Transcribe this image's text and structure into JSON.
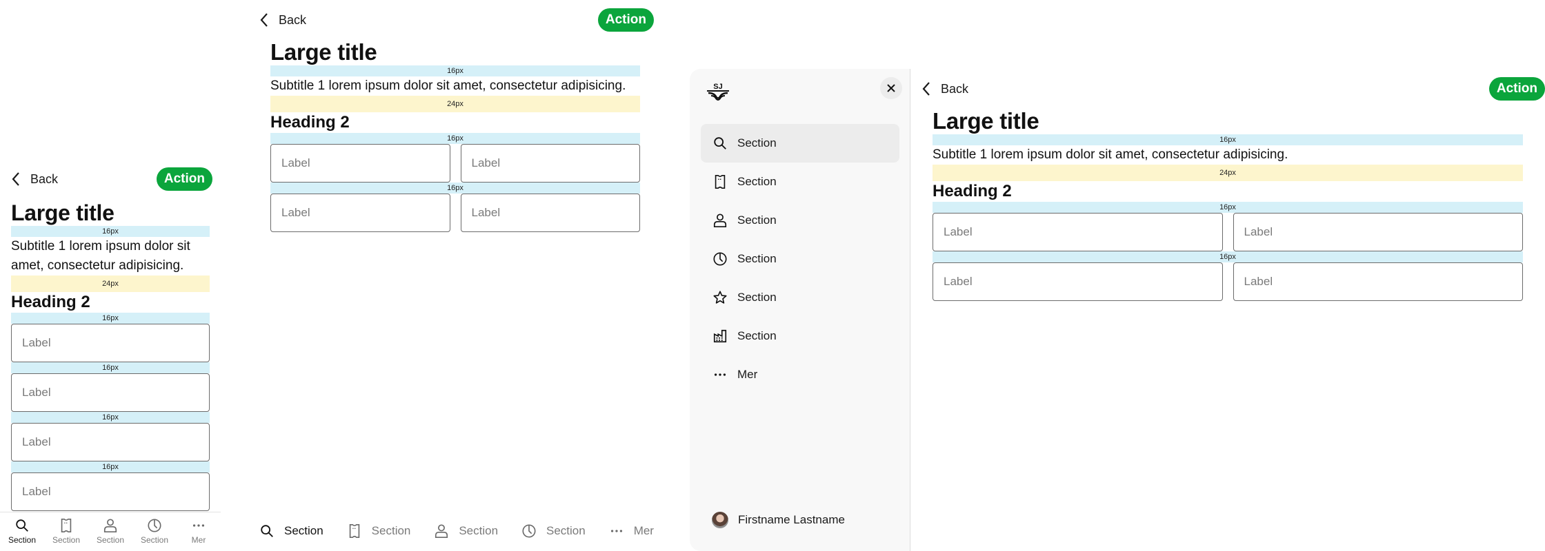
{
  "colors": {
    "action_green": "#0ba53c",
    "spacer_16": "#d5f0f8",
    "spacer_24": "#fdf5cd",
    "sidebar_bg": "#f8f8f8",
    "active_item_bg": "#ececec"
  },
  "topbar": {
    "back_label": "Back",
    "back_icon": "chevron-left-icon",
    "action_label": "Action"
  },
  "content": {
    "large_title": "Large title",
    "subtitle": "Subtitle 1 lorem ipsum dolor sit amet, consectetur adipisicing.",
    "heading2": "Heading 2",
    "spacer_16_label": "16px",
    "spacer_24_label": "24px",
    "field_label": "Label"
  },
  "mobile": {
    "fields": [
      "Label",
      "Label",
      "Label",
      "Label"
    ],
    "nav": [
      {
        "label": "Section",
        "icon": "search-icon",
        "active": true
      },
      {
        "label": "Section",
        "icon": "ticket-icon",
        "active": false
      },
      {
        "label": "Section",
        "icon": "person-icon",
        "active": false
      },
      {
        "label": "Section",
        "icon": "clock-icon",
        "active": false
      },
      {
        "label": "Mer",
        "icon": "more-icon",
        "active": false
      }
    ]
  },
  "tablet": {
    "fields": [
      "Label",
      "Label",
      "Label",
      "Label"
    ],
    "nav": [
      {
        "label": "Section",
        "icon": "search-icon",
        "active": true
      },
      {
        "label": "Section",
        "icon": "ticket-icon",
        "active": false
      },
      {
        "label": "Section",
        "icon": "person-icon",
        "active": false
      },
      {
        "label": "Section",
        "icon": "clock-icon",
        "active": false
      },
      {
        "label": "Mer",
        "icon": "more-icon",
        "active": false
      }
    ]
  },
  "desktop": {
    "sidebar": {
      "logo": "SJ",
      "close_icon": "close-icon",
      "items": [
        {
          "label": "Section",
          "icon": "search-icon",
          "active": true
        },
        {
          "label": "Section",
          "icon": "ticket-icon",
          "active": false
        },
        {
          "label": "Section",
          "icon": "person-icon",
          "active": false
        },
        {
          "label": "Section",
          "icon": "clock-icon",
          "active": false
        },
        {
          "label": "Section",
          "icon": "star-icon",
          "active": false
        },
        {
          "label": "Section",
          "icon": "building-icon",
          "active": false
        },
        {
          "label": "Mer",
          "icon": "more-icon",
          "active": false
        }
      ],
      "profile_name": "Firstname Lastname"
    },
    "fields": [
      "Label",
      "Label",
      "Label",
      "Label"
    ]
  }
}
